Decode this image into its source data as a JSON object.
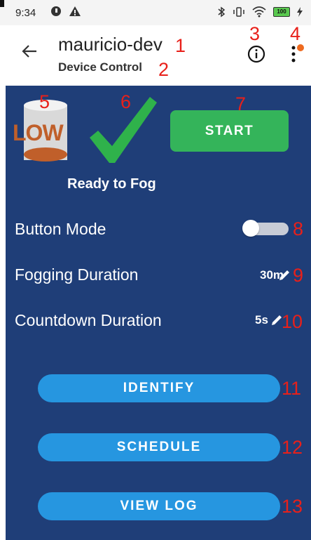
{
  "status_bar": {
    "time": "9:34",
    "left_icons": [
      "circle-app-icon",
      "warning-icon"
    ],
    "right_icons": [
      "bluetooth-icon",
      "vibrate-icon",
      "wifi-icon",
      "battery-icon",
      "charging-icon"
    ],
    "battery_level": "100"
  },
  "app_bar": {
    "title": "mauricio-dev",
    "subtitle": "Device Control",
    "back_icon": "arrow-back-icon",
    "info_icon": "info-icon",
    "more_icon": "more-vert-icon"
  },
  "device": {
    "tank_level_text": "LOW",
    "status_text": "Ready to Fog",
    "start_label": "START"
  },
  "settings": {
    "button_mode_label": "Button Mode",
    "button_mode_on": false,
    "fogging_duration_label": "Fogging Duration",
    "fogging_duration_value": "30m",
    "countdown_duration_label": "Countdown Duration",
    "countdown_duration_value": "5s"
  },
  "actions": {
    "identify_label": "IDENTIFY",
    "schedule_label": "SCHEDULE",
    "view_log_label": "VIEW LOG"
  },
  "annotations": [
    "1",
    "2",
    "3",
    "4",
    "5",
    "6",
    "7",
    "8",
    "9",
    "10",
    "11",
    "12",
    "13"
  ],
  "colors": {
    "panel": "#1f3e78",
    "start_button": "#34b45a",
    "action_button": "#2696e0",
    "annotation": "#e8201a",
    "badge": "#ee6a1f",
    "tank_text": "#c05f2a",
    "check": "#2fb24b"
  }
}
